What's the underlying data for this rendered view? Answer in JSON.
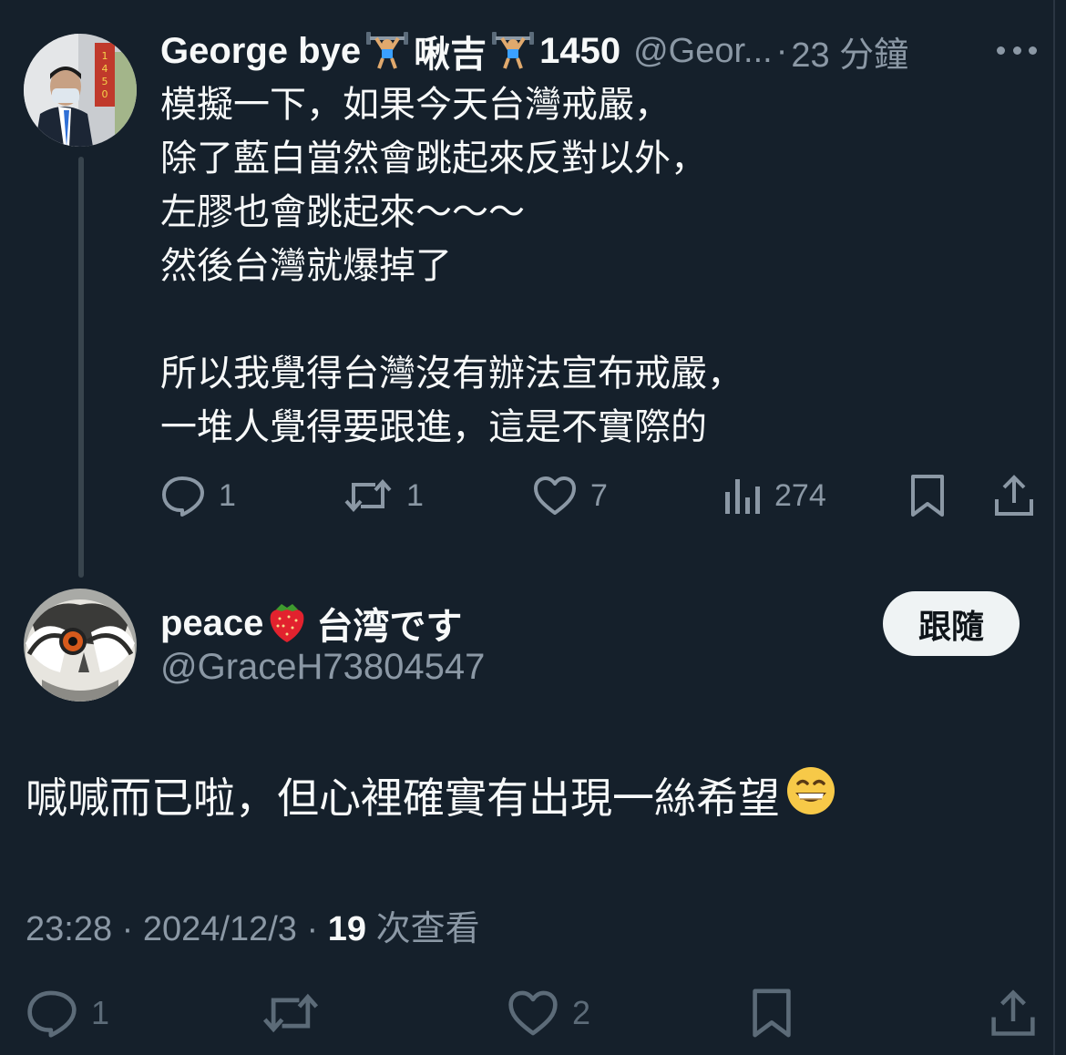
{
  "parent_tweet": {
    "display_name": "George bye",
    "name_emoji_1": "weight-lifter",
    "name_middle": "啾吉",
    "name_emoji_2": "weight-lifter",
    "name_suffix": "1450",
    "handle": "@Geor...",
    "separator": "·",
    "time_ago": "23 分鐘",
    "text_lines": [
      "模擬一下，如果今天台灣戒嚴，",
      "除了藍白當然會跳起來反對以外，",
      "左膠也會跳起來～～～",
      "然後台灣就爆掉了",
      "",
      "所以我覺得台灣沒有辦法宣布戒嚴，",
      "一堆人覺得要跟進，這是不實際的"
    ],
    "stats": {
      "replies": "1",
      "retweets": "1",
      "likes": "7",
      "views": "274"
    }
  },
  "reply_tweet": {
    "display_name": "peace",
    "name_emoji": "strawberry",
    "name_suffix": "台湾です",
    "handle": "@GraceH73804547",
    "follow_label": "跟隨",
    "text": "喊喊而已啦，但心裡確實有出現一絲希望",
    "text_emoji": "grinning-face",
    "time": "23:28",
    "sep1": "·",
    "date": "2024/12/3",
    "sep2": "·",
    "views_count": "19",
    "views_label": "次查看",
    "stats": {
      "replies": "1",
      "likes": "2"
    }
  },
  "colors": {
    "background": "#15202b",
    "text_primary": "#f7f9f9",
    "text_secondary": "#8b98a5",
    "button_bg": "#eff3f4"
  }
}
